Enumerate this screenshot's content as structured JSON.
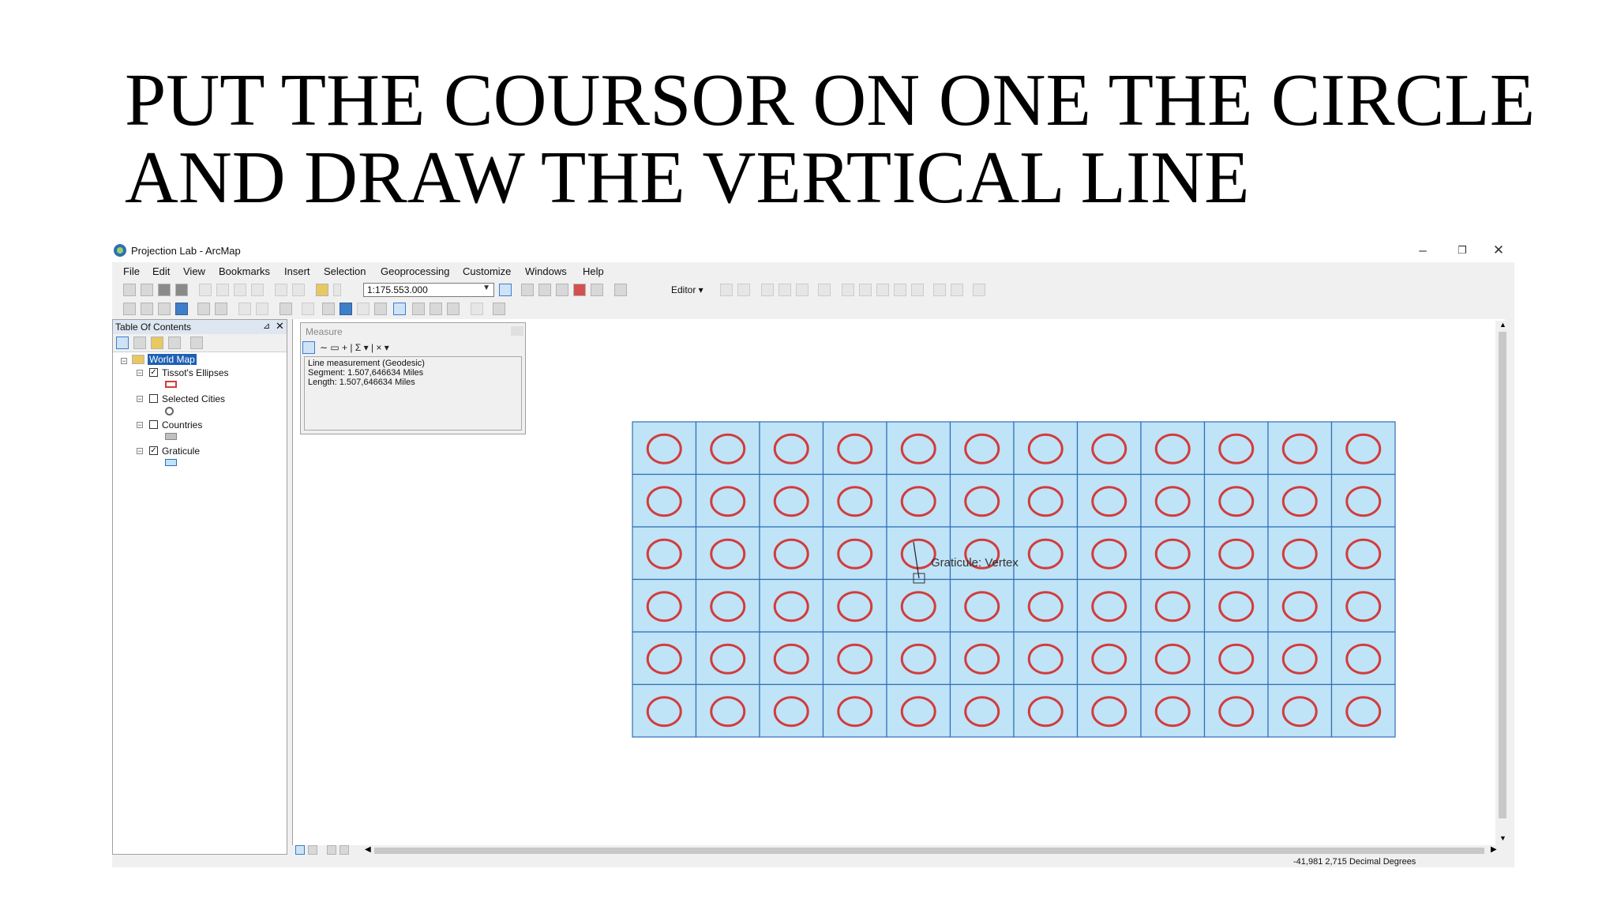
{
  "slide": {
    "title_line1": "PUT THE COURSOR ON ONE THE CIRCLE",
    "title_line2": "AND DRAW THE VERTICAL LINE"
  },
  "window": {
    "title": "Projection Lab - ArcMap",
    "minimize": "–",
    "restore": "❐",
    "close": "✕"
  },
  "menu": [
    "File",
    "Edit",
    "View",
    "Bookmarks",
    "Insert",
    "Selection",
    "Geoprocessing",
    "Customize",
    "Windows",
    "Help"
  ],
  "toolbar": {
    "scale": "1:175.553.000",
    "editor_label": "Editor ▾"
  },
  "toc": {
    "title": "Table Of Contents",
    "pin": "⊿",
    "close": "✕",
    "data_frame": "World Map",
    "layers": [
      {
        "name": "Tissot's Ellipses",
        "checked": true
      },
      {
        "name": "Selected Cities",
        "checked": false
      },
      {
        "name": "Countries",
        "checked": false
      },
      {
        "name": "Graticule",
        "checked": true
      }
    ]
  },
  "measure": {
    "title": "Measure",
    "tools": "∼  ▭  +  |  Σ ▾  |  × ▾",
    "line1": "Line measurement (Geodesic)",
    "line2": "Segment: 1.507,646634 Miles",
    "line3": "Length: 1.507,646634 Miles"
  },
  "map": {
    "columns": 12,
    "rows": 6,
    "cell_fill": "#bfe3f7",
    "grid_line": "#2f6fb5",
    "circle_stroke": "#d23c3c",
    "snap_tip": "Graticule: Vertex"
  },
  "status": {
    "coords": "-41,981  2,715 Decimal Degrees"
  },
  "colors": {
    "toc_header": "#dde6f1",
    "selection": "#1e5fb4"
  }
}
